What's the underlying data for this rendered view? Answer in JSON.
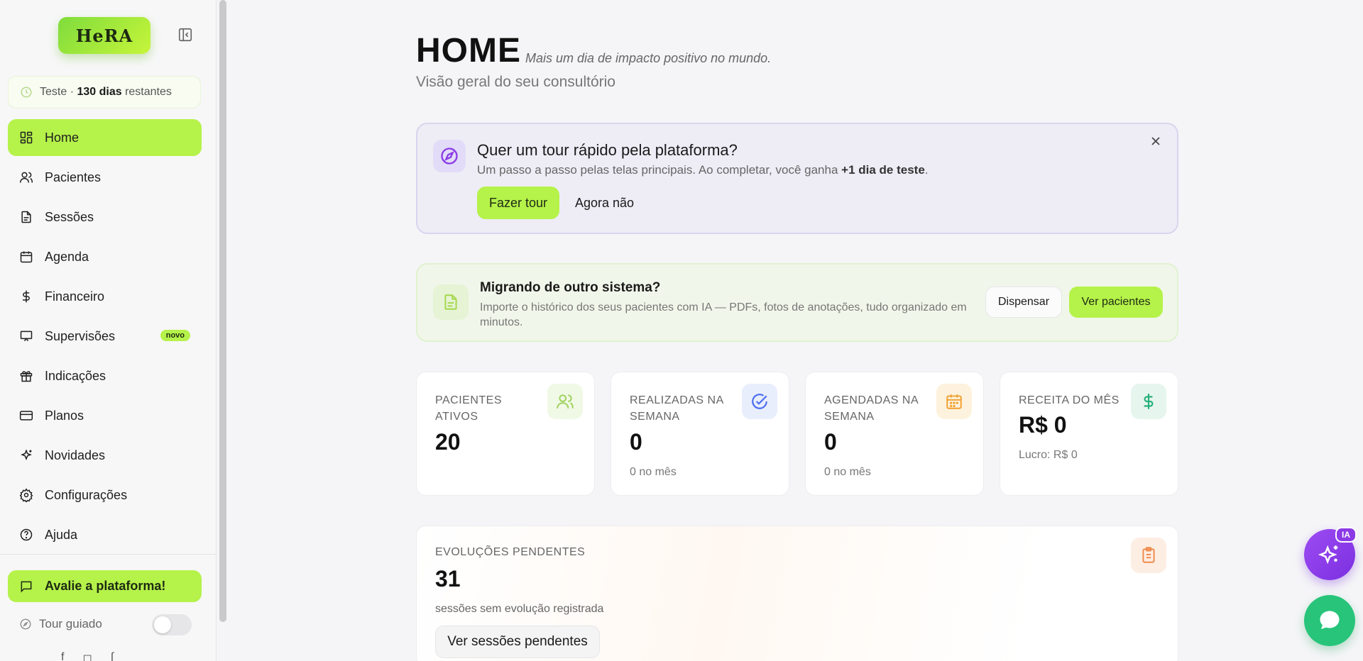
{
  "sidebar": {
    "logo_text": "HeRA",
    "trial": {
      "prefix": "Teste ·",
      "days": "130 dias",
      "suffix": "restantes"
    },
    "items": [
      {
        "label": "Home",
        "icon": "grid-icon",
        "active": true
      },
      {
        "label": "Pacientes",
        "icon": "users-icon"
      },
      {
        "label": "Sessões",
        "icon": "document-icon"
      },
      {
        "label": "Agenda",
        "icon": "calendar-icon"
      },
      {
        "label": "Financeiro",
        "icon": "dollar-icon"
      },
      {
        "label": "Supervisões",
        "icon": "presentation-icon",
        "badge": "novo"
      },
      {
        "label": "Indicações",
        "icon": "gift-icon"
      },
      {
        "label": "Planos",
        "icon": "credit-card-icon"
      },
      {
        "label": "Novidades",
        "icon": "sparkles-icon"
      },
      {
        "label": "Configurações",
        "icon": "gear-icon"
      },
      {
        "label": "Ajuda",
        "icon": "help-icon"
      }
    ],
    "rate_label": "Avalie a plataforma!",
    "tour_label": "Tour guiado"
  },
  "header": {
    "title": "HOME",
    "tagline": "Mais um dia de impacto positivo no mundo.",
    "subtitle": "Visão geral do seu consultório"
  },
  "tour_card": {
    "title": "Quer um tour rápido pela plataforma?",
    "text_prefix": "Um passo a passo pelas telas principais. Ao completar, você ganha",
    "text_bold": "+1 dia de teste",
    "text_suffix": ".",
    "primary_label": "Fazer tour",
    "secondary_label": "Agora não"
  },
  "migration_card": {
    "title": "Migrando de outro sistema?",
    "text": "Importe o histórico dos seus pacientes com IA — PDFs, fotos de anotações, tudo organizado em minutos.",
    "dismiss_label": "Dispensar",
    "primary_label": "Ver pacientes"
  },
  "stats": [
    {
      "label": "PACIENTES ATIVOS",
      "value": "20",
      "foot": ""
    },
    {
      "label": "REALIZADAS NA SEMANA",
      "value": "0",
      "foot": "0 no mês"
    },
    {
      "label": "AGENDADAS NA SEMANA",
      "value": "0",
      "foot": "0 no mês"
    },
    {
      "label": "RECEITA DO MÊS",
      "value": "R$ 0",
      "foot": "Lucro: R$ 0"
    }
  ],
  "evolutions": {
    "label": "EVOLUÇÕES PENDENTES",
    "value": "31",
    "text": "sessões sem evolução registrada",
    "button_label": "Ver sessões pendentes"
  },
  "fab": {
    "ai_badge": "IA"
  },
  "colors": {
    "accent": "#b5f24a",
    "purple": "#8b3ae6",
    "green": "#27c47a",
    "orange": "#f0a030",
    "blue": "#4a6cf0"
  }
}
